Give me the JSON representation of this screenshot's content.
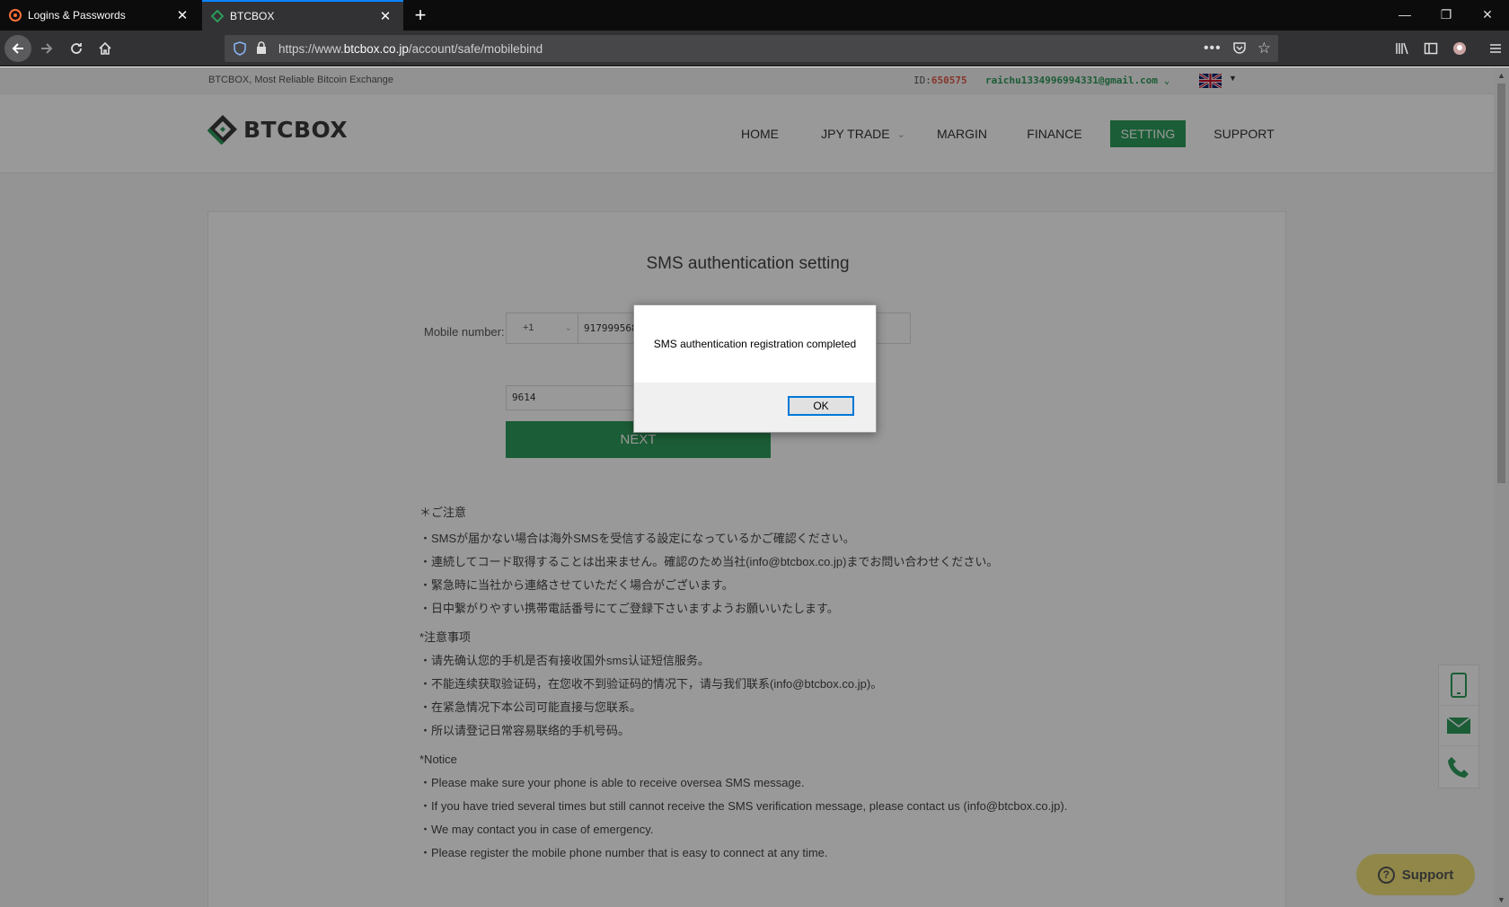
{
  "browser": {
    "tabs": [
      {
        "title": "Logins & Passwords",
        "active": false
      },
      {
        "title": "BTCBOX",
        "active": true
      }
    ],
    "url_prefix": "https://www.",
    "url_host": "btcbox.co.jp",
    "url_path": "/account/safe/mobilebind"
  },
  "top_strip": {
    "tagline": "BTCBOX, Most Reliable Bitcoin Exchange",
    "id_label": "ID:",
    "id_value": "650575",
    "email": "raichu1334996994331@gmail.com",
    "language": "English"
  },
  "header": {
    "logo_text": "BTCBOX",
    "nav": [
      "HOME",
      "JPY TRADE",
      "MARGIN",
      "FINANCE",
      "SETTING",
      "SUPPORT"
    ],
    "active_nav": "SETTING"
  },
  "form": {
    "title": "SMS authentication setting",
    "mobile_label": "Mobile number:",
    "country_code": "+1",
    "phone_number": "917999568",
    "verification_code": "9614",
    "next_label": "NEXT"
  },
  "notes": {
    "jp_head": "＊ご注意",
    "jp_lines": [
      "・SMSが届かない場合は海外SMSを受信する設定になっているかご確認ください。",
      "・連続してコード取得することは出来ません。確認のため当社(info@btcbox.co.jp)までお問い合わせください。",
      "・緊急時に当社から連絡させていただく場合がございます。",
      "・日中繋がりやすい携帯電話番号にてご登録下さいますようお願いいたします。"
    ],
    "cn_head": "*注意事项",
    "cn_lines": [
      "・请先确认您的手机是否有接收国外sms认证短信服务。",
      "・不能连续获取验证码，在您收不到验证码的情况下，请与我们联系(info@btcbox.co.jp)。",
      "・在紧急情况下本公司可能直接与您联系。",
      "・所以请登记日常容易联络的手机号码。"
    ],
    "en_head": "*Notice",
    "en_lines": [
      "・Please make sure your phone is able to receive oversea SMS message.",
      "・If you have tried several times but still cannot receive the SMS verification message, please contact us (info@btcbox.co.jp).",
      "・We may contact you in case of emergency.",
      "・Please register the mobile phone number that is easy to connect at any time."
    ]
  },
  "support_button": "Support",
  "dialog": {
    "message": "SMS authentication registration completed",
    "ok_label": "OK"
  },
  "colors": {
    "brand_green": "#2e9b5a",
    "id_red": "#e05a49",
    "support_yellow": "#f0e27a"
  }
}
